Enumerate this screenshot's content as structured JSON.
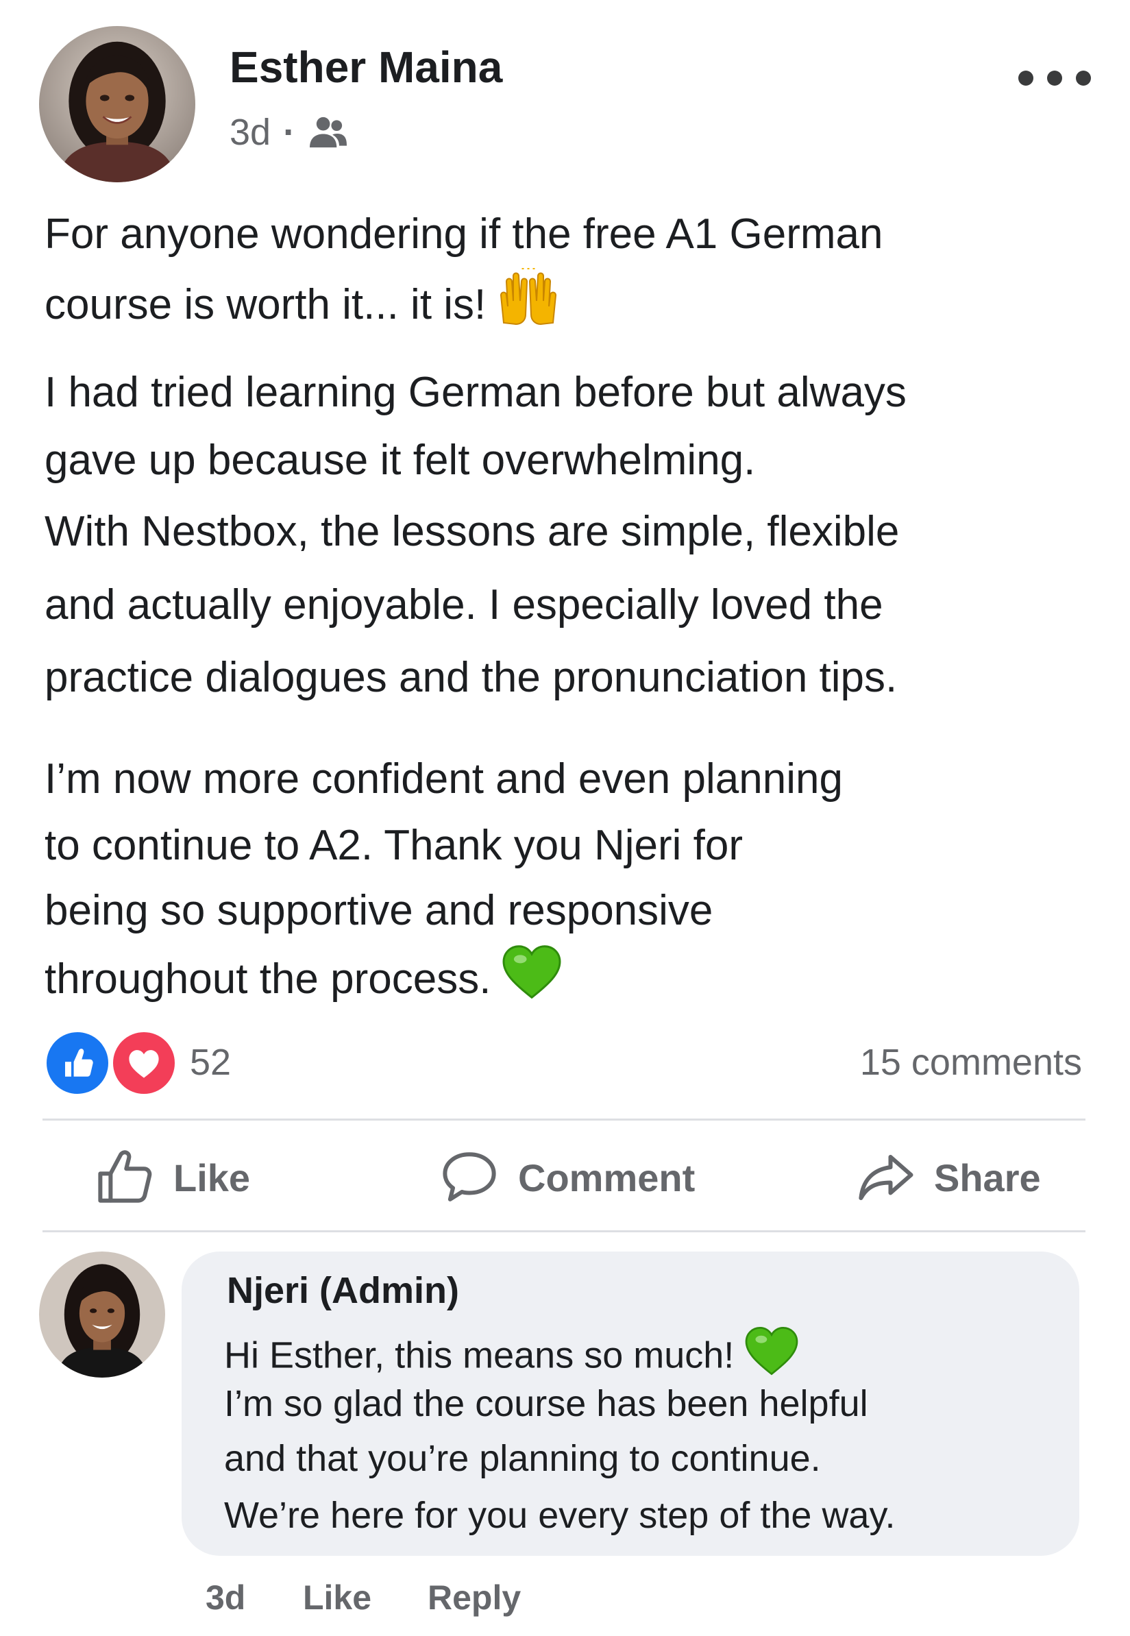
{
  "post": {
    "author": "Esther Maina",
    "time": "3d",
    "audience_icon": "group-icon",
    "more_icon": "more-options-icon",
    "paragraph1": [
      "For anyone wondering if the free A1 German",
      "course is worth it... it is!"
    ],
    "paragraph1_emoji": "raising-hands-emoji",
    "paragraph2": [
      "I had tried learning German before but always",
      "gave up because it felt overwhelming.",
      "With Nestbox, the lessons are simple, flexible",
      "and actually enjoyable. I especially loved the",
      "practice dialogues and the pronunciation tips."
    ],
    "paragraph3": [
      "I’m now more confident and even planning",
      "to continue to A2. Thank you Njeri for",
      "being so supportive and responsive",
      "throughout the process."
    ],
    "paragraph3_emoji": "green-heart-emoji"
  },
  "reactions": {
    "types": [
      "like",
      "love"
    ],
    "count": "52",
    "comments": "15 comments"
  },
  "actions": {
    "like": "Like",
    "comment": "Comment",
    "share": "Share"
  },
  "comment": {
    "author": "Njeri (Admin)",
    "lines": [
      "Hi Esther, this means so much!",
      "I’m so glad the course has been helpful",
      "and that you’re planning to continue.",
      "We’re here for you every step of the way."
    ],
    "emoji": "green-heart-emoji",
    "time": "3d",
    "like": "Like",
    "reply": "Reply"
  },
  "colors": {
    "like_blue": "#1877f2",
    "love_red": "#f33e58",
    "green_heart": "#4cbb17",
    "secondary_text": "#65676b",
    "bubble": "#eef0f4"
  }
}
